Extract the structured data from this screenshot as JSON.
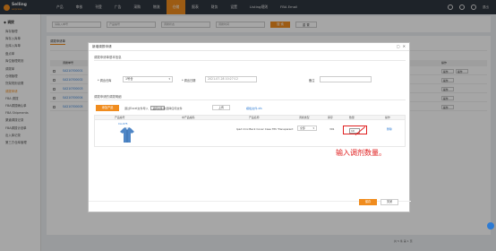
{
  "app": {
    "logo_text": "Selling",
    "logo_sub": "express"
  },
  "nav": {
    "items": [
      "产品",
      "审核",
      "刊登",
      "广告",
      "采购",
      "物流",
      "仓储",
      "报表",
      "财务",
      "设置",
      "Listing规则",
      "FBA Email"
    ],
    "active_index": 6
  },
  "top_right": {
    "user": "退出"
  },
  "sidebar": {
    "header": "◆ 调拨",
    "items": [
      "库存管理",
      "库存入库单",
      "出库入库单",
      "盘点单",
      "库位管理规则",
      "调拨单",
      "仓储管理",
      "货架规则设置",
      "调拨申请",
      "FBA 调拨",
      "FBA调拨确认单",
      "FBA Shipments",
      "渠道调拨记录",
      "FBA调拨计划单",
      "出入库记录",
      "第三方仓库管理"
    ],
    "active_index": 8
  },
  "filterbar": {
    "placeholders": [
      "请输入单号",
      "产品编号",
      "调拨状态",
      "调拨时间"
    ],
    "search_label": "搜 索",
    "reset_label": "重 置"
  },
  "list": {
    "tab_label": "调拨申请单",
    "headers": [
      "调拨单号",
      "操作"
    ],
    "rows": [
      "SA210700001",
      "SA210700002",
      "SA210700003",
      "SA210700004",
      "SA210700005"
    ],
    "op_label": "操作",
    "pager": "共 5 条 第 1 页"
  },
  "modal": {
    "title": "新增调拨申请",
    "basic_section": "调拨申请单基本信息",
    "warehouse_label": "* 调出仓库",
    "warehouse_value": "1号仓",
    "date_label": "* 调出日期",
    "date_value": "2021-07-28 10:27:12",
    "remark_label": "备注",
    "detail_section": "调拨申请的调拨明细",
    "add_label": "添加产品",
    "import_text": "通过Excel文件导入",
    "choose_file": "选择文件",
    "no_file": "未选择任何文件",
    "upload_label": "上传",
    "template_link": "模板文件.xls",
    "table_headers": [
      "产品编号",
      "中产品编码",
      "产品名称",
      "调拨类型",
      "库存",
      "数量",
      "操作"
    ],
    "row": {
      "sku": "CA-075",
      "name": "Ipad mini Back Cover Case TPU Transparent",
      "type": "全部",
      "stock": "391",
      "qty": "10",
      "op": "删除"
    },
    "ok_label": "保存",
    "cancel_label": "关闭"
  },
  "annotation": "输入调剂数量。"
}
